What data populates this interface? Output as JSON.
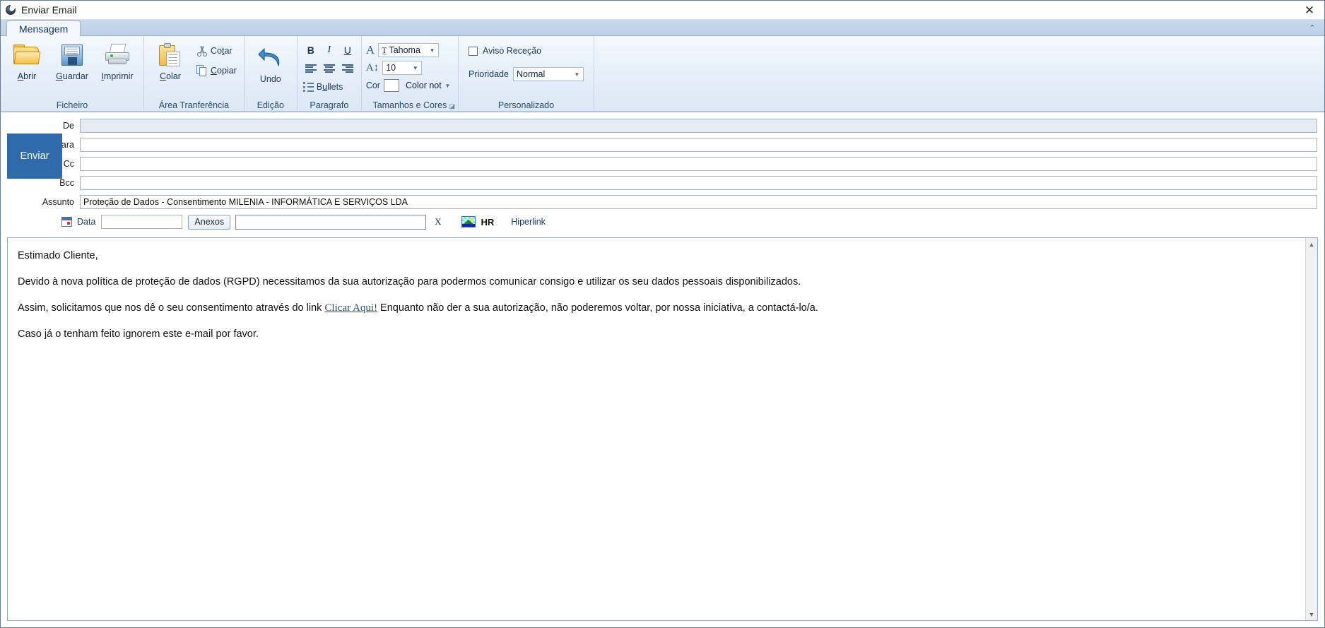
{
  "window": {
    "title": "Enviar Email",
    "app_icon": "app-ball-icon",
    "close_label": "✕",
    "collapse_label": "⌃"
  },
  "ribbon": {
    "tab": "Mensagem",
    "groups": {
      "ficheiro": {
        "label": "Ficheiro",
        "buttons": [
          {
            "label": "Abrir",
            "accel": "A",
            "icon": "folder-open-icon"
          },
          {
            "label": "Guardar",
            "accel": "G",
            "icon": "floppy-disk-icon"
          },
          {
            "label": "Imprimir",
            "accel": "I",
            "icon": "printer-icon"
          }
        ]
      },
      "clipboard": {
        "label": "Área Tranferência",
        "paste": {
          "label": "Colar",
          "icon": "clipboard-paste-icon"
        },
        "cut": {
          "label": "Cotar",
          "icon": "scissors-icon"
        },
        "copy": {
          "label": "Copiar",
          "icon": "copy-icon"
        }
      },
      "edicao": {
        "label": "Edição",
        "undo": {
          "label": "Undo",
          "icon": "undo-arrow-icon"
        }
      },
      "paragrafo": {
        "label": "Paragrafo",
        "bold": "B",
        "italic": "I",
        "underline": "U",
        "align_left": "align-left-icon",
        "align_center": "align-center-icon",
        "align_right": "align-right-icon",
        "bullets": "Bullets"
      },
      "tamanhos": {
        "label": "Tamanhos e Cores",
        "dialog_launcher": "⌐",
        "font_icon": "font-letter-icon",
        "font_value": "Tahoma",
        "size_icon": "font-size-icon",
        "size_value": "10",
        "color_label": "Cor",
        "color_value": "Color not",
        "color_swatch": "#ffffff"
      },
      "personalizado": {
        "label": "Personalizado",
        "receipt_label": "Aviso Receção",
        "receipt_checked": false,
        "priority_label": "Prioridade",
        "priority_value": "Normal"
      }
    }
  },
  "compose": {
    "send_button": "Enviar",
    "fields": [
      {
        "label": "De",
        "value": "",
        "readonly": true
      },
      {
        "label": "Para",
        "value": "",
        "readonly": false
      },
      {
        "label": "Cc",
        "value": "",
        "readonly": false
      },
      {
        "label": "Bcc",
        "value": "",
        "readonly": false
      }
    ],
    "subject": {
      "label": "Assunto",
      "value": "Proteção de Dados - Consentimento MILENIA - INFORMÁTICA E SERVIÇOS LDA"
    },
    "meta": {
      "calendar_icon": "calendar-icon",
      "date_label": "Data",
      "date_value": "",
      "attach_button": "Anexos",
      "attach_value": "",
      "clear_attach": "X",
      "image_icon": "picture-icon",
      "hr_label": "HR",
      "hyperlink_label": "Hiperlink"
    }
  },
  "body": {
    "greeting": "Estimado Cliente,",
    "paragraph1": "Devido à nova política de proteção de dados (RGPD) necessitamos da sua autorização para podermos comunicar consigo e utilizar os seu dados pessoais disponibilizados.",
    "paragraph2_pre": "Assim, solicitamos que nos dê o seu consentimento através do link ",
    "link_text": "Clicar Aqui!",
    "paragraph2_post": " Enquanto não der a sua autorização, não poderemos voltar, por nossa iniciativa, a contactá-lo/a.",
    "paragraph3": "Caso já o tenham feito ignorem este e-mail por favor."
  },
  "scroll": {
    "up": "▲",
    "down": "▼"
  },
  "colors": {
    "accent": "#2f6aab",
    "ribbon": "#dce8f6",
    "link": "#1f4e96"
  }
}
